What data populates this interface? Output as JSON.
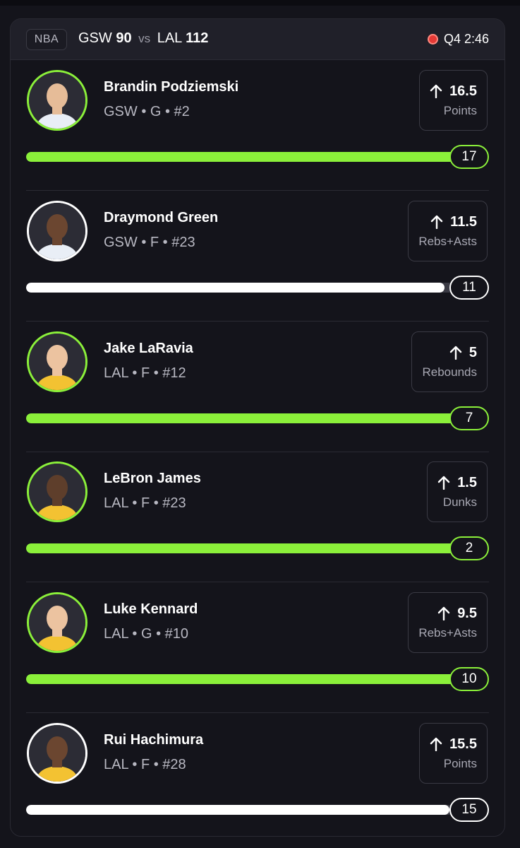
{
  "header": {
    "league": "NBA",
    "away_team": "GSW",
    "away_score": "90",
    "vs": "vs",
    "home_team": "LAL",
    "home_score": "112",
    "status": "Q4 2:46"
  },
  "players": [
    {
      "name": "Brandin Podziemski",
      "info": "GSW • G • #2",
      "line": "16.5",
      "stat": "Points",
      "actual": "17",
      "progress": 1.0,
      "hit": true,
      "jersey": "#e9eef6",
      "skin": "#e6bc98"
    },
    {
      "name": "Draymond Green",
      "info": "GSW • F • #23",
      "line": "11.5",
      "stat": "Rebs+Asts",
      "actual": "11",
      "progress": 0.957,
      "hit": false,
      "jersey": "#e9eef6",
      "skin": "#6b4630"
    },
    {
      "name": "Jake LaRavia",
      "info": "LAL • F • #12",
      "line": "5",
      "stat": "Rebounds",
      "actual": "7",
      "progress": 1.0,
      "hit": true,
      "jersey": "#f3c232",
      "skin": "#ecc3a0"
    },
    {
      "name": "LeBron James",
      "info": "LAL • F • #23",
      "line": "1.5",
      "stat": "Dunks",
      "actual": "2",
      "progress": 1.0,
      "hit": true,
      "jersey": "#f3c232",
      "skin": "#5e3e2b"
    },
    {
      "name": "Luke Kennard",
      "info": "LAL • G • #10",
      "line": "9.5",
      "stat": "Rebs+Asts",
      "actual": "10",
      "progress": 1.0,
      "hit": true,
      "jersey": "#f3c232",
      "skin": "#ecc3a0"
    },
    {
      "name": "Rui Hachimura",
      "info": "LAL • F • #28",
      "line": "15.5",
      "stat": "Points",
      "actual": "15",
      "progress": 0.968,
      "hit": false,
      "jersey": "#f3c232",
      "skin": "#6b4630"
    }
  ],
  "colors": {
    "accent_green": "#8bf03a",
    "live_red": "#e53935",
    "background": "#14141b"
  },
  "icons": {
    "line_arrow": "arrow-up-icon",
    "live": "live-dot-icon"
  }
}
